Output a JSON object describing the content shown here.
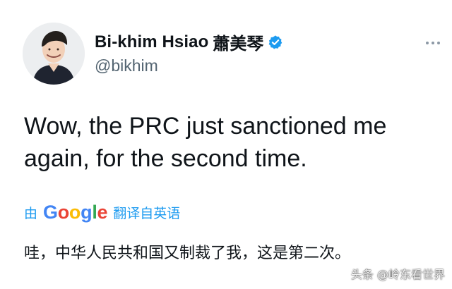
{
  "user": {
    "display_name": "Bi-khim Hsiao",
    "cjk_name": "蕭美琴",
    "handle": "@bikhim",
    "verified": true
  },
  "tweet": {
    "text": "Wow, the PRC just sanctioned me again, for the second time."
  },
  "translation": {
    "by_prefix": "由",
    "provider_letters": [
      "G",
      "o",
      "o",
      "g",
      "l",
      "e"
    ],
    "link_text": "翻译自英语",
    "translated_text": "哇，中华人民共和国又制裁了我，这是第二次。"
  },
  "watermark": {
    "text": "头条 @岭东看世界"
  },
  "colors": {
    "accent": "#1d9bf0",
    "text_primary": "#0f1419",
    "text_secondary": "#536471",
    "google_blue": "#4285f4",
    "google_red": "#ea4335",
    "google_yellow": "#fbbc05",
    "google_green": "#34a853"
  },
  "icons": {
    "verified": "verified-badge-icon",
    "more": "more-options-icon"
  }
}
